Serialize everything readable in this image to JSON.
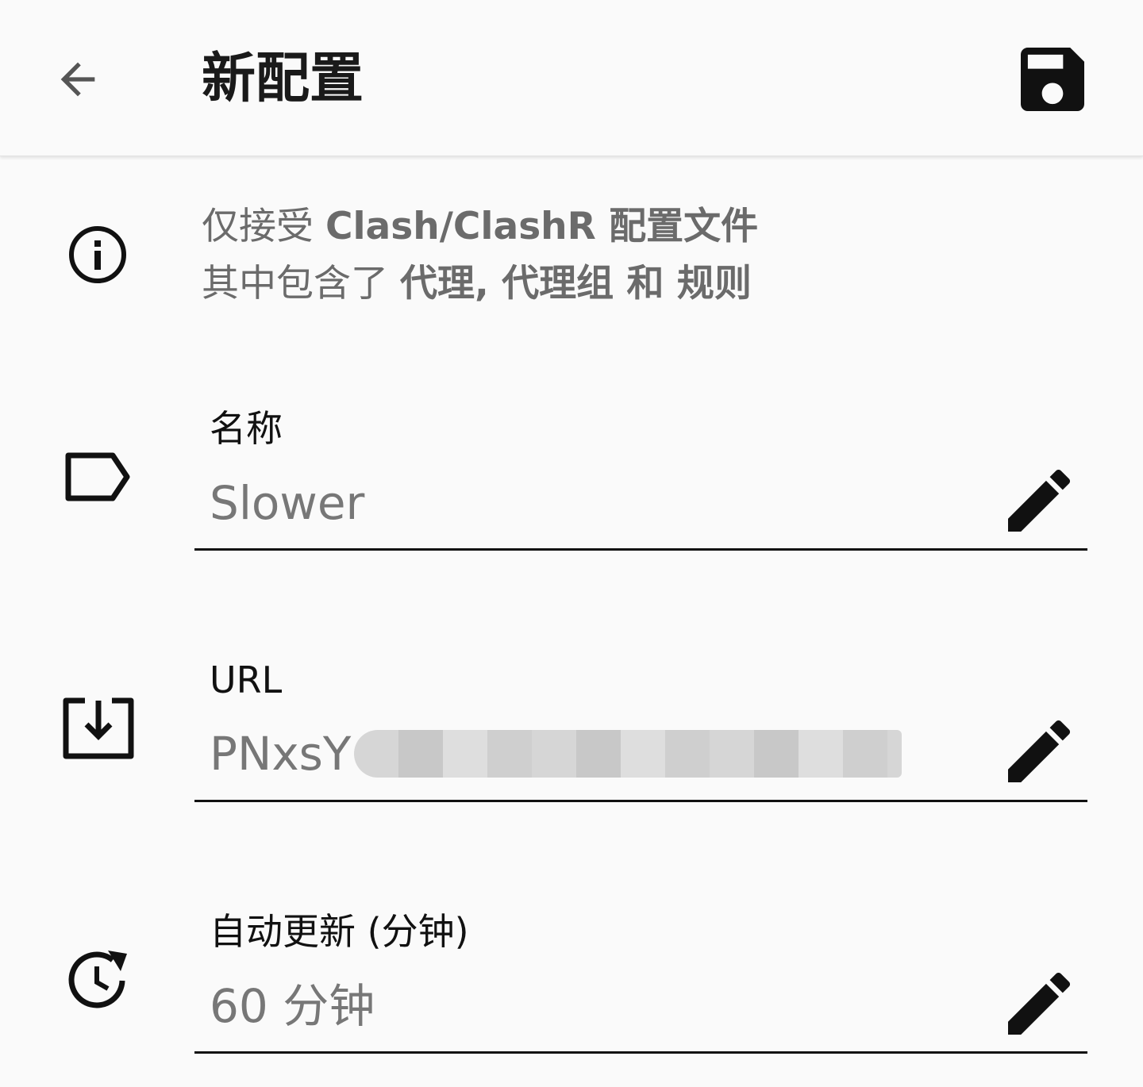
{
  "app_bar": {
    "title": "新配置",
    "back_icon": "arrow-back-icon",
    "save_icon": "save-icon"
  },
  "info": {
    "icon": "info-icon",
    "line1_prefix": "仅接受 ",
    "line1_bold": "Clash/ClashR 配置文件",
    "line2_prefix": "其中包含了 ",
    "line2_bold": "代理, 代理组 和 规则"
  },
  "fields": {
    "name": {
      "icon": "label-icon",
      "label": "名称",
      "value": "Slower",
      "edit_icon": "edit-icon"
    },
    "url": {
      "icon": "download-icon",
      "label": "URL",
      "value": "PNxsY",
      "edit_icon": "edit-icon"
    },
    "auto_update": {
      "icon": "update-icon",
      "label": "自动更新 (分钟)",
      "value": "60 分钟",
      "edit_icon": "edit-icon"
    }
  },
  "colors": {
    "background": "#fafafa",
    "primary_text": "#111111",
    "secondary_text": "#777777",
    "info_text": "#6b6b6b"
  }
}
